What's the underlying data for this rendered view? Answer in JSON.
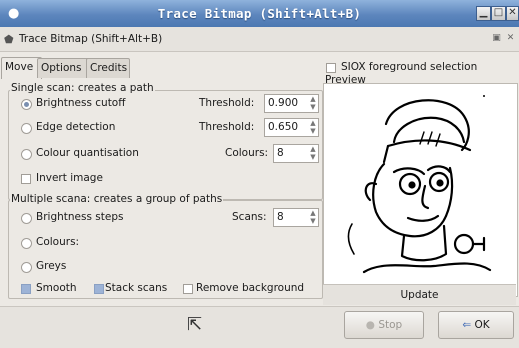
{
  "window": {
    "title": "Trace Bitmap (Shift+Alt+B)",
    "menu_icon": "●",
    "buttons": {
      "minimize": "▁",
      "maximize": "□",
      "close": "✕"
    }
  },
  "dock": {
    "title": "Trace Bitmap (Shift+Alt+B)",
    "icon": "⬟"
  },
  "tabs": [
    "Move",
    "Options",
    "Credits"
  ],
  "single_scan": {
    "title": "Single scan: creates a path",
    "brightness_cutoff": {
      "label": "Brightness cutoff",
      "selected": true,
      "field_label": "Threshold:",
      "value": "0.900"
    },
    "edge_detection": {
      "label": "Edge detection",
      "selected": false,
      "field_label": "Threshold:",
      "value": "0.650"
    },
    "colour_quantisation": {
      "label": "Colour quantisation",
      "selected": false,
      "field_label": "Colours:",
      "value": "8"
    },
    "invert": {
      "label": "Invert image",
      "checked": false
    }
  },
  "multiple_scans": {
    "title": "Multiple scana: creates a group of paths",
    "brightness_steps": {
      "label": "Brightness steps",
      "selected": false,
      "field_label": "Scans:",
      "value": "8"
    },
    "colours": {
      "label": "Colours:",
      "selected": false
    },
    "greys": {
      "label": "Greys",
      "selected": false
    },
    "smooth": {
      "label": "Smooth",
      "checked": true
    },
    "stack_scans": {
      "label": "Stack scans",
      "checked": true
    },
    "remove_background": {
      "label": "Remove background",
      "checked": false
    }
  },
  "siox": {
    "label": "SIOX foreground selection",
    "checked": false
  },
  "preview": {
    "title": "Preview",
    "update_label": "Update"
  },
  "footer": {
    "stop_label": "Stop",
    "ok_label": "OK"
  }
}
